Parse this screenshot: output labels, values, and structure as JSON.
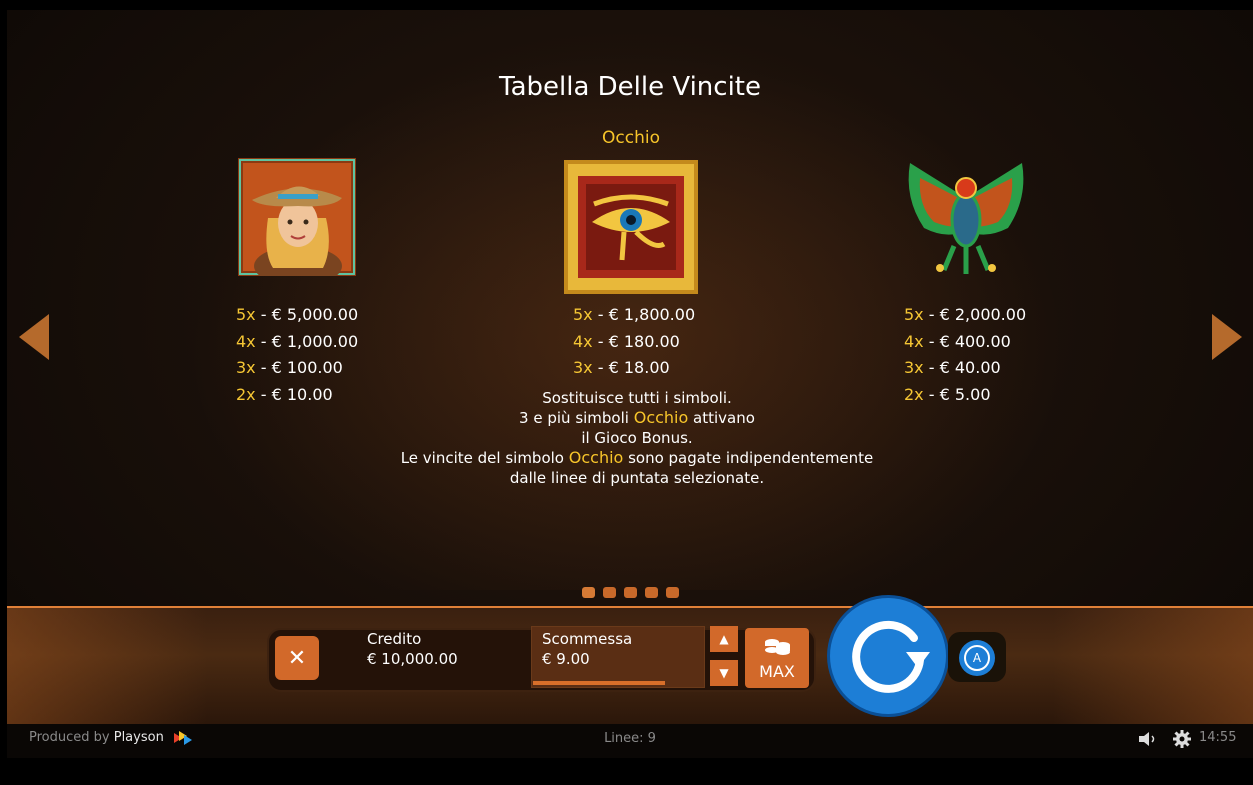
{
  "title": "Tabella Delle Vincite",
  "symbols": [
    {
      "name": "",
      "icon": "explorer-woman-icon",
      "pays": [
        {
          "mult": "5x",
          "sep": " - ",
          "amount": "€ 5,000.00"
        },
        {
          "mult": "4x",
          "sep": " - ",
          "amount": "€ 1,000.00"
        },
        {
          "mult": "3x",
          "sep": " - ",
          "amount": "€ 100.00"
        },
        {
          "mult": "2x",
          "sep": " - ",
          "amount": "€ 10.00"
        }
      ]
    },
    {
      "name": "Occhio",
      "icon": "eye-of-horus-icon",
      "pays": [
        {
          "mult": "5x",
          "sep": " - ",
          "amount": "€ 1,800.00"
        },
        {
          "mult": "4x",
          "sep": " - ",
          "amount": "€ 180.00"
        },
        {
          "mult": "3x",
          "sep": " - ",
          "amount": "€ 18.00"
        }
      ]
    },
    {
      "name": "",
      "icon": "winged-scarab-icon",
      "pays": [
        {
          "mult": "5x",
          "sep": " - ",
          "amount": "€ 2,000.00"
        },
        {
          "mult": "4x",
          "sep": " - ",
          "amount": "€ 400.00"
        },
        {
          "mult": "3x",
          "sep": " - ",
          "amount": "€ 40.00"
        },
        {
          "mult": "2x",
          "sep": " - ",
          "amount": "€ 5.00"
        }
      ]
    }
  ],
  "description": {
    "line1": "Sostituisce tutti i simboli.",
    "line2_a": "3 e più simboli ",
    "line2_hl": "Occhio",
    "line2_b": " attivano",
    "line3": "il Gioco Bonus.",
    "line4_a": "Le vincite del simbolo ",
    "line4_hl": "Occhio",
    "line4_b": " sono pagate indipendentemente",
    "line5": "dalle linee di puntata selezionate."
  },
  "pagination": {
    "count": 5,
    "active_index": 0
  },
  "controls": {
    "close_symbol": "✕",
    "credit_label": "Credito",
    "credit_value": "€ 10,000.00",
    "bet_label": "Scommessa",
    "bet_value": "€ 9.00",
    "bet_level": 0.77,
    "up_symbol": "▲",
    "down_symbol": "▼",
    "max_label": "MAX",
    "auto_symbol": "A"
  },
  "footer": {
    "produced_prefix": "Produced by ",
    "produced_brand": "Playson",
    "lines": "Linee: 9",
    "time": "14:55"
  },
  "colors": {
    "accent": "#d2692a",
    "highlight": "#f7c52a",
    "spin": "#1d7ed6"
  }
}
